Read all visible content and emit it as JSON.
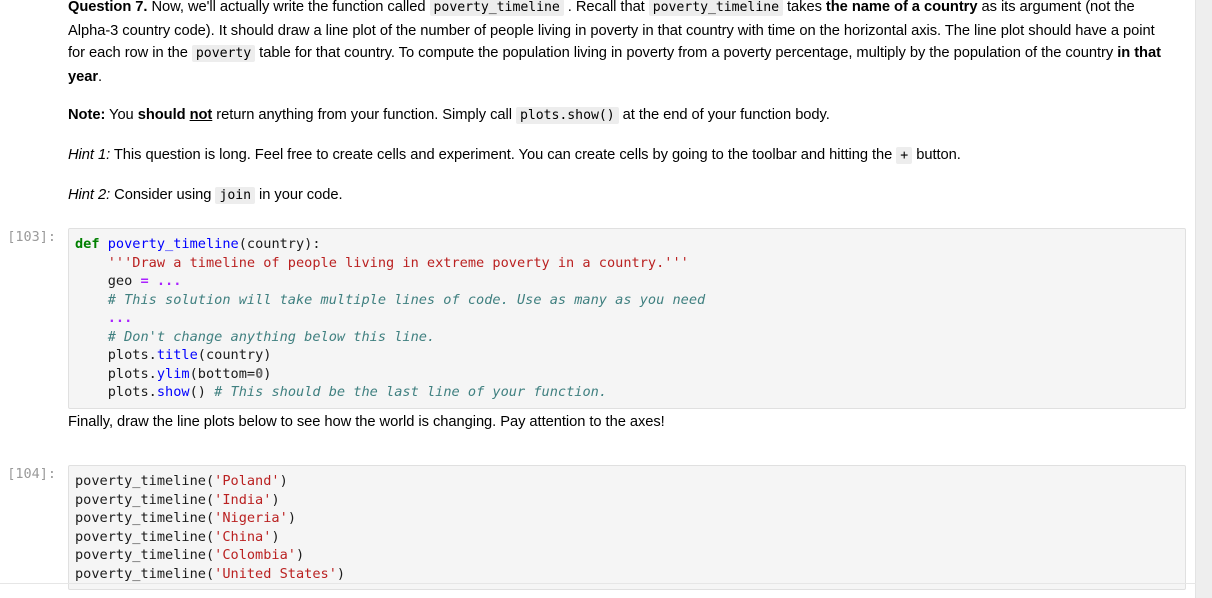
{
  "notebook": {
    "markdown_blocks": [
      {
        "id": "question-7",
        "paragraphs": [
          "Question 7. Now, we'll actually write the function called poverty_timeline . Recall that poverty_timeline takes the name of a country as its argument (not the Alpha-3 country code). It should draw a line plot of the number of people living in poverty in that country with time on the horizontal axis. The line plot should have a point for each row in the poverty table for that country. To compute the population living in poverty from a poverty percentage, multiply by the population of the country in that year.",
          "Note: You should not return anything from your function. Simply call plots.show() at the end of your function body.",
          "Hint 1: This question is long. Feel free to create cells and experiment. You can create cells by going to the toolbar and hitting the + button.",
          "Hint 2: Consider using join in your code."
        ],
        "labels": {
          "question_label": "Question 7.",
          "note_label": "Note:",
          "hint1_label": "Hint 1:",
          "hint2_label": "Hint 2:",
          "bold_should": "should",
          "bold_not": "not",
          "bold_name_of_country": "the name of a country",
          "bold_in_that_year": "in that year"
        },
        "inline_code": {
          "poverty_timeline": "poverty_timeline",
          "poverty": "poverty",
          "plots_show": "plots.show()",
          "plus": "+",
          "join": "join"
        },
        "text_runs": {
          "q_a": " Now, we'll actually write the function called ",
          "q_b": " . Recall that ",
          "q_c": " takes ",
          "q_d": " as its argument (not the Alpha-3 country code). It should draw a line plot of the number of people living in poverty in that country with time on the horizontal axis. The line plot should have a point for each row in the ",
          "q_e": " table for that country. To compute the population living in poverty from a poverty percentage, multiply by the population of the country ",
          "q_f": ".",
          "n_a": " You ",
          "n_b": " ",
          "n_c": " return anything from your function. Simply call ",
          "n_d": " at the end of your function body.",
          "h1_a": " This question is long. Feel free to create cells and experiment. You can create cells by going to the toolbar and hitting the ",
          "h1_b": " button.",
          "h2_a": " Consider using ",
          "h2_b": " in your code."
        }
      },
      {
        "id": "finally-note",
        "paragraphs": [
          "Finally, draw the line plots below to see how the world is changing. Pay attention to the axes!"
        ]
      }
    ],
    "code_cells": [
      {
        "prompt": "[103]:",
        "lines": [
          "def poverty_timeline(country):",
          "    '''Draw a timeline of people living in extreme poverty in a country.'''",
          "    geo = ...",
          "    # This solution will take multiple lines of code. Use as many as you need",
          "    ...",
          "    # Don't change anything below this line.",
          "    plots.title(country)",
          "    plots.ylim(bottom=0)",
          "    plots.show() # This should be the last line of your function."
        ],
        "tokens": {
          "def": "def",
          "fn_name": "poverty_timeline",
          "open_paren_country": "(country):",
          "docstring": "'''Draw a timeline of people living in extreme poverty in a country.'''",
          "geo": "geo",
          "eq": "=",
          "ellipsis": "...",
          "comment1": "# This solution will take multiple lines of code. Use as many as you need",
          "comment2": "# Don't change anything below this line.",
          "plots": "plots.",
          "title": "title",
          "title_args": "(country)",
          "ylim": "ylim",
          "ylim_args_open": "(bottom=",
          "ylim_zero": "0",
          "ylim_args_close": ")",
          "show": "show",
          "show_args": "()",
          "comment3": "# This should be the last line of your function."
        }
      },
      {
        "prompt": "[104]:",
        "call_name": "poverty_timeline",
        "calls": [
          {
            "name": "poverty_timeline",
            "arg": "'Poland'"
          },
          {
            "name": "poverty_timeline",
            "arg": "'India'"
          },
          {
            "name": "poverty_timeline",
            "arg": "'Nigeria'"
          },
          {
            "name": "poverty_timeline",
            "arg": "'China'"
          },
          {
            "name": "poverty_timeline",
            "arg": "'Colombia'"
          },
          {
            "name": "poverty_timeline",
            "arg": "'United States'"
          }
        ]
      }
    ]
  },
  "colors": {
    "cell_background": "#f5f5f5",
    "cell_border": "#e0e0e0",
    "inline_code_background": "#ededed",
    "prompt_text": "#9a9a9a",
    "keyword": "#008000",
    "function": "#0000ff",
    "string": "#ba2121",
    "comment": "#408080",
    "operator": "#aa22ff",
    "page_gutter": "#eeeeee"
  }
}
